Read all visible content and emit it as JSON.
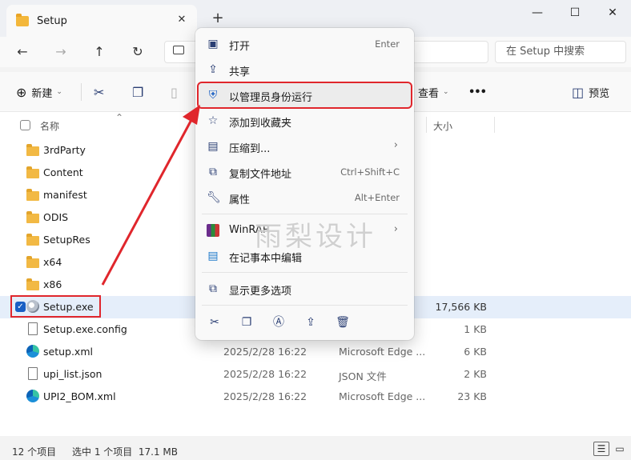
{
  "window": {
    "tab_title": "Setup",
    "tab_close": "✕",
    "new_tab": "+",
    "minimize": "—",
    "maximize": "☐",
    "close": "✕"
  },
  "nav": {
    "search_placeholder": "在 Setup 中搜索"
  },
  "toolbar": {
    "new_label": "新建",
    "sort_label": "查看",
    "more": "•••",
    "preview_label": "预览"
  },
  "columns": {
    "name": "名称",
    "size": "大小"
  },
  "files": [
    {
      "name": "3rdParty",
      "kind": "folder",
      "date": "",
      "type": "",
      "size": ""
    },
    {
      "name": "Content",
      "kind": "folder",
      "date": "",
      "type": "",
      "size": ""
    },
    {
      "name": "manifest",
      "kind": "folder",
      "date": "",
      "type": "",
      "size": ""
    },
    {
      "name": "ODIS",
      "kind": "folder",
      "date": "",
      "type": "",
      "size": ""
    },
    {
      "name": "SetupRes",
      "kind": "folder",
      "date": "",
      "type": "",
      "size": ""
    },
    {
      "name": "x64",
      "kind": "folder",
      "date": "",
      "type": "",
      "size": ""
    },
    {
      "name": "x86",
      "kind": "folder",
      "date": "",
      "type": "",
      "size": ""
    },
    {
      "name": "Setup.exe",
      "kind": "exe",
      "date": "",
      "type": "",
      "size": "17,566 KB"
    },
    {
      "name": "Setup.exe.config",
      "kind": "doc",
      "date": "",
      "type": "",
      "size": "1 KB"
    },
    {
      "name": "setup.xml",
      "kind": "edge",
      "date": "2025/2/28 16:22",
      "type": "Microsoft Edge ...",
      "size": "6 KB"
    },
    {
      "name": "upi_list.json",
      "kind": "doc",
      "date": "2025/2/28 16:22",
      "type": "JSON 文件",
      "size": "2 KB"
    },
    {
      "name": "UPI2_BOM.xml",
      "kind": "edge",
      "date": "2025/2/28 16:22",
      "type": "Microsoft Edge ...",
      "size": "23 KB"
    }
  ],
  "context_menu": {
    "open": {
      "label": "打开",
      "shortcut": "Enter"
    },
    "share": {
      "label": "共享"
    },
    "run_as_admin": {
      "label": "以管理员身份运行"
    },
    "add_favorites": {
      "label": "添加到收藏夹"
    },
    "compress": {
      "label": "压缩到..."
    },
    "copy_path": {
      "label": "复制文件地址",
      "shortcut": "Ctrl+Shift+C"
    },
    "properties": {
      "label": "属性",
      "shortcut": "Alt+Enter"
    },
    "winrar": {
      "label": "WinRAR"
    },
    "notepad": {
      "label": "在记事本中编辑"
    },
    "more_options": {
      "label": "显示更多选项"
    }
  },
  "status": {
    "count": "12 个项目",
    "selected": "选中 1 个项目  17.1 MB"
  },
  "watermark": "雨梨设计",
  "colors": {
    "highlight_red": "#e0262c",
    "selection_blue": "#1a5fc4",
    "folder_yellow": "#f2b944"
  }
}
